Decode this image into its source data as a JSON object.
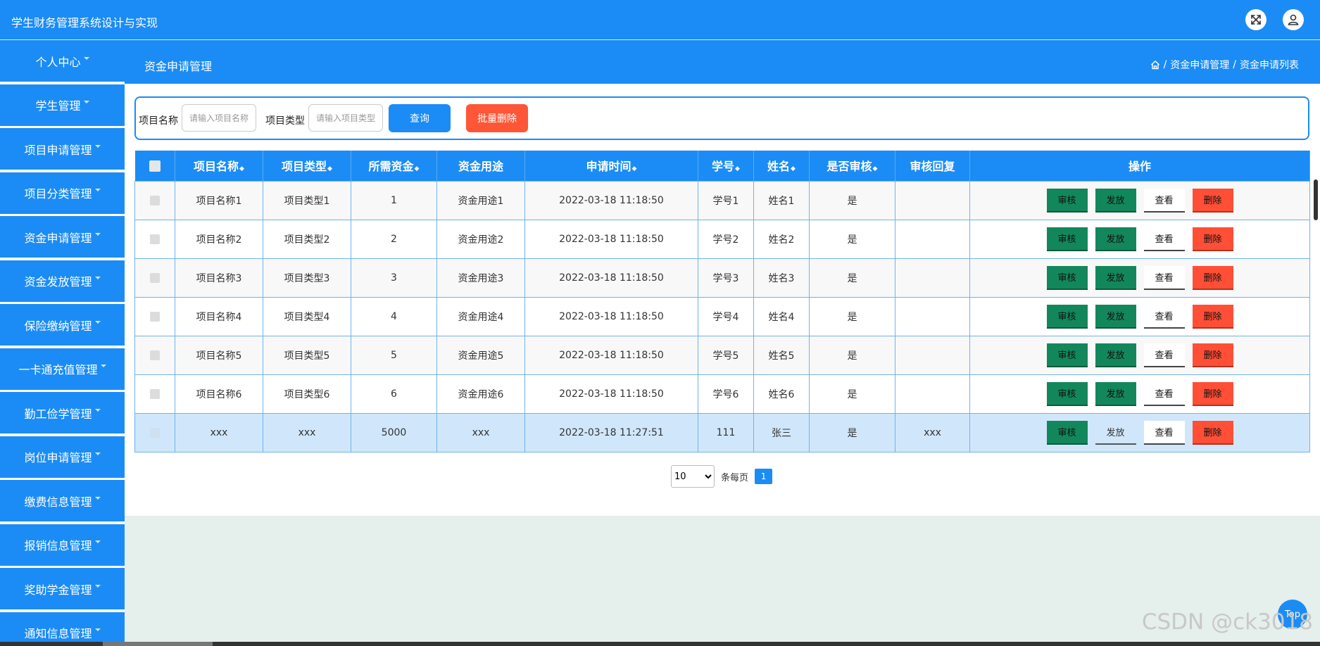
{
  "app": {
    "title": "学生财务管理系统设计与实现"
  },
  "sidebar": {
    "items": [
      {
        "label": "个人中心"
      },
      {
        "label": "学生管理"
      },
      {
        "label": "项目申请管理"
      },
      {
        "label": "项目分类管理"
      },
      {
        "label": "资金申请管理"
      },
      {
        "label": "资金发放管理"
      },
      {
        "label": "保险缴纳管理"
      },
      {
        "label": "一卡通充值管理"
      },
      {
        "label": "勤工俭学管理"
      },
      {
        "label": "岗位申请管理"
      },
      {
        "label": "缴费信息管理"
      },
      {
        "label": "报销信息管理"
      },
      {
        "label": "奖助学金管理"
      },
      {
        "label": "通知信息管理"
      }
    ]
  },
  "subheader": {
    "title": "资金申请管理",
    "breadcrumb": {
      "sep": "/",
      "level1": "资金申请管理",
      "level2": "资金申请列表"
    }
  },
  "search": {
    "name_label": "项目名称",
    "name_placeholder": "请输入项目名称",
    "type_label": "项目类型",
    "type_placeholder": "请输入项目类型",
    "query_label": "查询",
    "batch_delete_label": "批量删除"
  },
  "table": {
    "sort_glyph": "◆",
    "headers": {
      "name": "项目名称",
      "type": "项目类型",
      "amount": "所需资金",
      "purpose": "资金用途",
      "time": "申请时间",
      "student_id": "学号",
      "student_name": "姓名",
      "audited": "是否审核",
      "reply": "审核回复",
      "actions": "操作"
    },
    "actions": {
      "audit": "审核",
      "issue": "发放",
      "view": "查看",
      "delete": "删除"
    },
    "rows": [
      {
        "name": "项目名称1",
        "type": "项目类型1",
        "amount": "1",
        "purpose": "资金用途1",
        "time": "2022-03-18 11:18:50",
        "student_id": "学号1",
        "student_name": "姓名1",
        "audited": "是",
        "reply": ""
      },
      {
        "name": "项目名称2",
        "type": "项目类型2",
        "amount": "2",
        "purpose": "资金用途2",
        "time": "2022-03-18 11:18:50",
        "student_id": "学号2",
        "student_name": "姓名2",
        "audited": "是",
        "reply": ""
      },
      {
        "name": "项目名称3",
        "type": "项目类型3",
        "amount": "3",
        "purpose": "资金用途3",
        "time": "2022-03-18 11:18:50",
        "student_id": "学号3",
        "student_name": "姓名3",
        "audited": "是",
        "reply": ""
      },
      {
        "name": "项目名称4",
        "type": "项目类型4",
        "amount": "4",
        "purpose": "资金用途4",
        "time": "2022-03-18 11:18:50",
        "student_id": "学号4",
        "student_name": "姓名4",
        "audited": "是",
        "reply": ""
      },
      {
        "name": "项目名称5",
        "type": "项目类型5",
        "amount": "5",
        "purpose": "资金用途5",
        "time": "2022-03-18 11:18:50",
        "student_id": "学号5",
        "student_name": "姓名5",
        "audited": "是",
        "reply": ""
      },
      {
        "name": "项目名称6",
        "type": "项目类型6",
        "amount": "6",
        "purpose": "资金用途6",
        "time": "2022-03-18 11:18:50",
        "student_id": "学号6",
        "student_name": "姓名6",
        "audited": "是",
        "reply": ""
      },
      {
        "name": "xxx",
        "type": "xxx",
        "amount": "5000",
        "purpose": "xxx",
        "time": "2022-03-18 11:27:51",
        "student_id": "111",
        "student_name": "张三",
        "audited": "是",
        "reply": "xxx"
      }
    ]
  },
  "pagination": {
    "page_size": "10",
    "page_size_options": [
      "10"
    ],
    "per_page_label": "条每页",
    "current_page": "1"
  },
  "top_button": {
    "label": "Top"
  },
  "watermark": {
    "text": "CSDN @ck3018"
  },
  "colors": {
    "primary": "#1b8cf5",
    "danger": "#ff5637",
    "success": "#13875c"
  }
}
